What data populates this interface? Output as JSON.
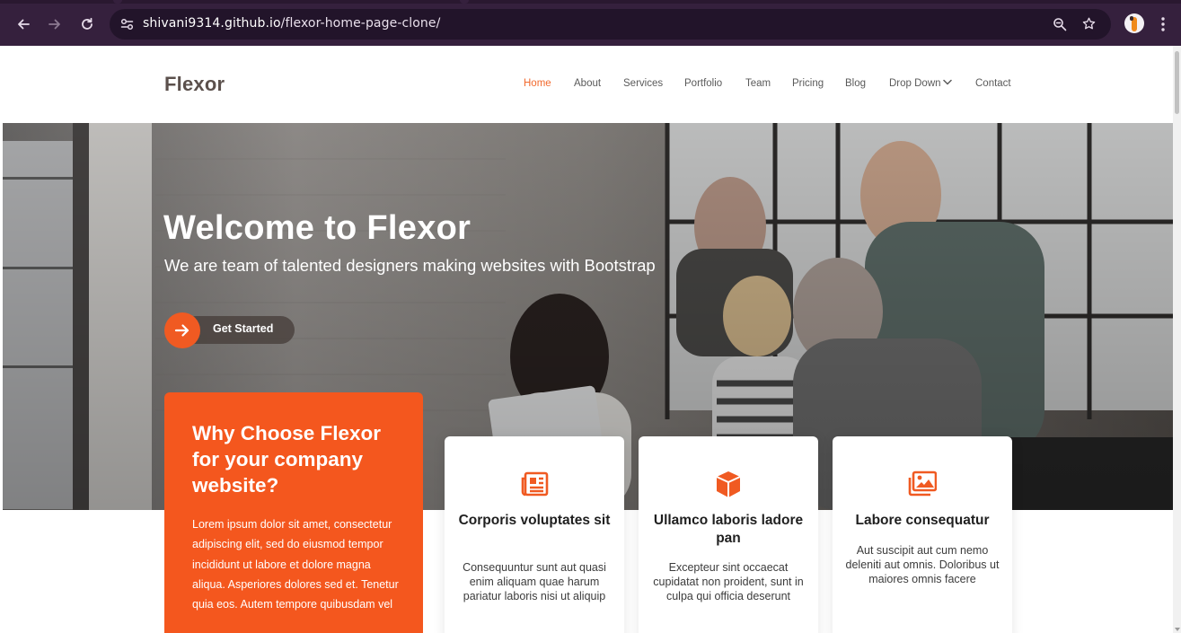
{
  "browser": {
    "url_host": "shivani9314.github.io",
    "url_path": "/flexor-home-page-clone/"
  },
  "header": {
    "logo": "Flexor",
    "nav": [
      {
        "label": "Home",
        "active": true
      },
      {
        "label": "About"
      },
      {
        "label": "Services"
      },
      {
        "label": "Portfolio"
      },
      {
        "label": "Team"
      },
      {
        "label": "Pricing"
      },
      {
        "label": "Blog"
      },
      {
        "label": "Drop Down"
      },
      {
        "label": "Contact"
      }
    ]
  },
  "hero": {
    "title": "Welcome to Flexor",
    "subtitle": "We are team of talented designers making websites with Bootstrap",
    "cta_label": "Get Started"
  },
  "why": {
    "title": "Why Choose Flexor for your company website?",
    "text": "Lorem ipsum dolor sit amet, consectetur adipiscing elit, sed do eiusmod tempor incididunt ut labore et dolore magna aliqua. Asperiores dolores sed et. Tenetur quia eos. Autem tempore quibusdam vel"
  },
  "cards": [
    {
      "icon": "newspaper-icon",
      "title": "Corporis voluptates sit",
      "desc": "Consequuntur sunt aut quasi enim aliquam quae harum pariatur laboris nisi ut aliquip"
    },
    {
      "icon": "cube-icon",
      "title": "Ullamco laboris ladore pan",
      "desc": "Excepteur sint occaecat cupidatat non proident, sunt in culpa qui officia deserunt"
    },
    {
      "icon": "images-icon",
      "title": "Labore consequatur",
      "desc": "Aut suscipit aut cum nemo deleniti aut omnis. Doloribus ut maiores omnis facere"
    }
  ],
  "colors": {
    "accent": "#f4571e",
    "browser_bar": "#35203d"
  }
}
